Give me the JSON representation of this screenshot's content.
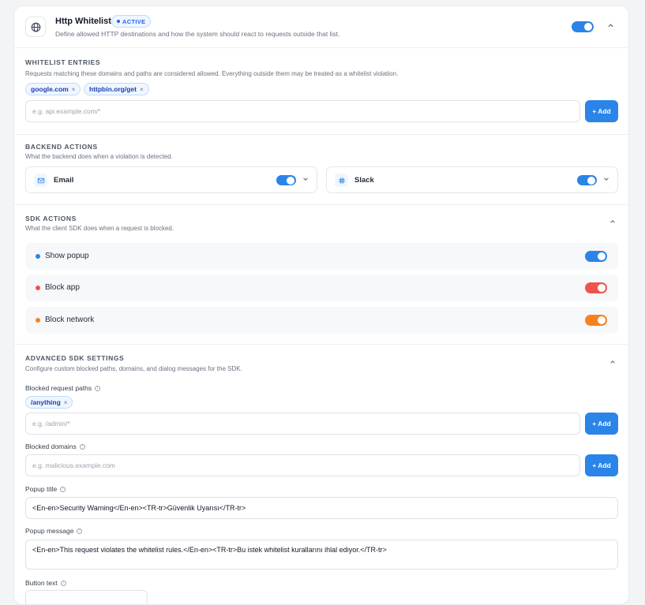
{
  "header": {
    "title": "Http Whitelist",
    "badge": "ACTIVE",
    "description": "Define allowed HTTP destinations and how the system should react to requests outside that list.",
    "enabled": true,
    "globe_icon": "globe-icon",
    "collapse_icon": "chevron-up-icon"
  },
  "whitelist": {
    "title": "WHITELIST ENTRIES",
    "description": "Requests matching these domains and paths are considered allowed. Everything outside them may be treated as a whitelist violation.",
    "entries": [
      "google.com",
      "httpbin.org/get"
    ],
    "placeholder": "e.g. api.example.com/*",
    "add_label": "+ Add"
  },
  "backend": {
    "title": "BACKEND ACTIONS",
    "description": "What the backend does when a violation is detected.",
    "actions": [
      {
        "label": "Email",
        "icon": "mail-icon",
        "enabled": true
      },
      {
        "label": "Slack",
        "icon": "slack-icon",
        "enabled": true
      }
    ]
  },
  "sdk": {
    "title": "SDK ACTIONS",
    "description": "What the client SDK does when a request is blocked.",
    "actions": [
      {
        "label": "Show popup",
        "color": "#2b84e8",
        "enabled": true
      },
      {
        "label": "Block app",
        "color": "#ef5350",
        "enabled": true
      },
      {
        "label": "Block network",
        "color": "#f5821f",
        "enabled": true
      }
    ]
  },
  "advanced": {
    "title": "ADVANCED SDK SETTINGS",
    "description": "Configure custom blocked paths, domains, and dialog messages for the SDK.",
    "paths_label": "Blocked request paths",
    "paths": [
      "/anything"
    ],
    "paths_placeholder": "e.g. /admin/*",
    "domains_label": "Blocked domains",
    "domains_placeholder": "e.g. malicious.example.com",
    "add_label": "+ Add",
    "popup_title_label": "Popup title",
    "popup_title_value": "<En-en>Security Warning</En-en><TR-tr>Güvenlik Uyarısı</TR-tr>",
    "popup_message_label": "Popup message",
    "popup_message_value": "<En-en>This request violates the whitelist rules.</En-en><TR-tr>Bu istek whitelist kurallarını ihlal ediyor.</TR-tr>",
    "button_text_label": "Button text"
  }
}
